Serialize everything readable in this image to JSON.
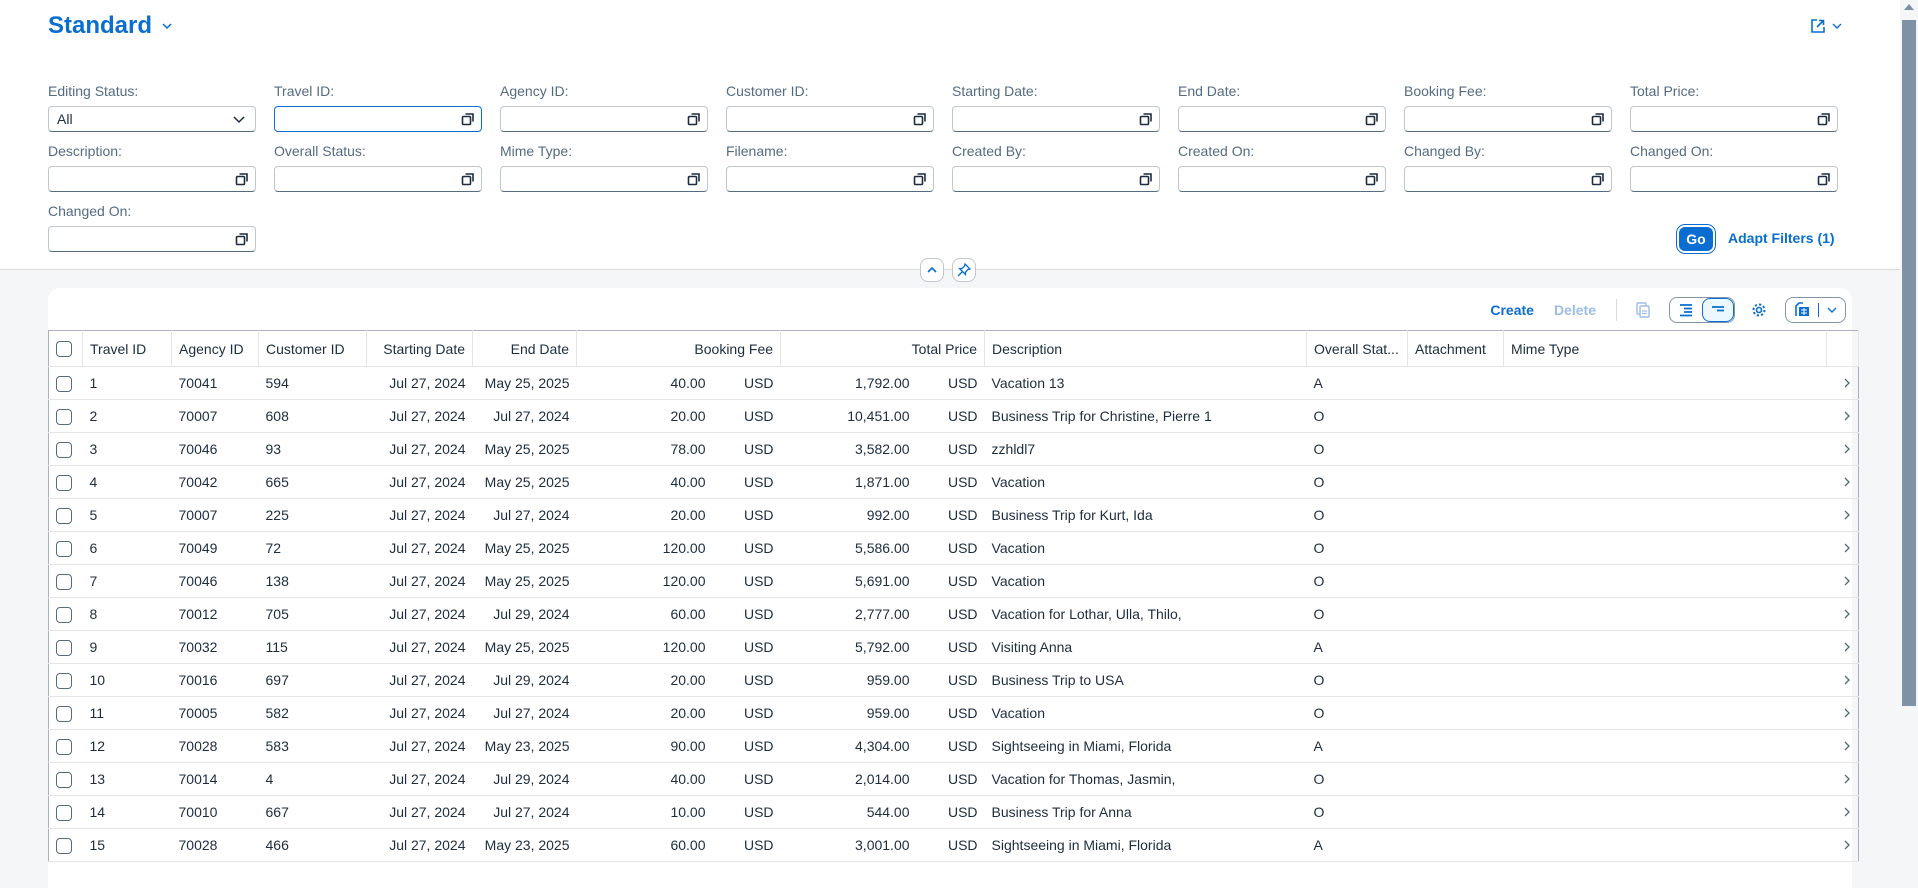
{
  "header": {
    "title": "Standard",
    "share_icon": "share-icon"
  },
  "filters": [
    {
      "label": "Editing Status:",
      "value": "All",
      "type": "select"
    },
    {
      "label": "Travel ID:",
      "value": "",
      "type": "valuehelp",
      "focused": true
    },
    {
      "label": "Agency ID:",
      "value": "",
      "type": "valuehelp"
    },
    {
      "label": "Customer ID:",
      "value": "",
      "type": "valuehelp"
    },
    {
      "label": "Starting Date:",
      "value": "",
      "type": "valuehelp"
    },
    {
      "label": "End Date:",
      "value": "",
      "type": "valuehelp"
    },
    {
      "label": "Booking Fee:",
      "value": "",
      "type": "valuehelp"
    },
    {
      "label": "Total Price:",
      "value": "",
      "type": "valuehelp"
    },
    {
      "label": "Description:",
      "value": "",
      "type": "valuehelp"
    },
    {
      "label": "Overall Status:",
      "value": "",
      "type": "valuehelp"
    },
    {
      "label": "Mime Type:",
      "value": "",
      "type": "valuehelp"
    },
    {
      "label": "Filename:",
      "value": "",
      "type": "valuehelp"
    },
    {
      "label": "Created By:",
      "value": "",
      "type": "valuehelp"
    },
    {
      "label": "Created On:",
      "value": "",
      "type": "valuehelp"
    },
    {
      "label": "Changed By:",
      "value": "",
      "type": "valuehelp"
    },
    {
      "label": "Changed On:",
      "value": "",
      "type": "valuehelp"
    },
    {
      "label": "Changed On:",
      "value": "",
      "type": "valuehelp"
    }
  ],
  "filterbar": {
    "go_label": "Go",
    "adapt_label": "Adapt Filters (1)"
  },
  "toolbar": {
    "create_label": "Create",
    "delete_label": "Delete"
  },
  "table": {
    "columns": [
      "Travel ID",
      "Agency ID",
      "Customer ID",
      "Starting Date",
      "End Date",
      "Booking Fee",
      "Total Price",
      "Description",
      "Overall Stat...",
      "Attachment",
      "Mime Type"
    ],
    "rows": [
      {
        "travel_id": "1",
        "agency_id": "70041",
        "customer_id": "594",
        "start": "Jul 27, 2024",
        "end": "May 25, 2025",
        "fee": "40.00",
        "fee_cur": "USD",
        "total": "1,792.00",
        "total_cur": "USD",
        "desc": "Vacation 13",
        "status": "A",
        "attachment": "",
        "mime": ""
      },
      {
        "travel_id": "2",
        "agency_id": "70007",
        "customer_id": "608",
        "start": "Jul 27, 2024",
        "end": "Jul 27, 2024",
        "fee": "20.00",
        "fee_cur": "USD",
        "total": "10,451.00",
        "total_cur": "USD",
        "desc": "Business Trip for Christine, Pierre 1",
        "status": "O",
        "attachment": "",
        "mime": ""
      },
      {
        "travel_id": "3",
        "agency_id": "70046",
        "customer_id": "93",
        "start": "Jul 27, 2024",
        "end": "May 25, 2025",
        "fee": "78.00",
        "fee_cur": "USD",
        "total": "3,582.00",
        "total_cur": "USD",
        "desc": "zzhldl7",
        "status": "O",
        "attachment": "",
        "mime": ""
      },
      {
        "travel_id": "4",
        "agency_id": "70042",
        "customer_id": "665",
        "start": "Jul 27, 2024",
        "end": "May 25, 2025",
        "fee": "40.00",
        "fee_cur": "USD",
        "total": "1,871.00",
        "total_cur": "USD",
        "desc": "Vacation",
        "status": "O",
        "attachment": "",
        "mime": ""
      },
      {
        "travel_id": "5",
        "agency_id": "70007",
        "customer_id": "225",
        "start": "Jul 27, 2024",
        "end": "Jul 27, 2024",
        "fee": "20.00",
        "fee_cur": "USD",
        "total": "992.00",
        "total_cur": "USD",
        "desc": "Business Trip for Kurt, Ida",
        "status": "O",
        "attachment": "",
        "mime": ""
      },
      {
        "travel_id": "6",
        "agency_id": "70049",
        "customer_id": "72",
        "start": "Jul 27, 2024",
        "end": "May 25, 2025",
        "fee": "120.00",
        "fee_cur": "USD",
        "total": "5,586.00",
        "total_cur": "USD",
        "desc": "Vacation",
        "status": "O",
        "attachment": "",
        "mime": ""
      },
      {
        "travel_id": "7",
        "agency_id": "70046",
        "customer_id": "138",
        "start": "Jul 27, 2024",
        "end": "May 25, 2025",
        "fee": "120.00",
        "fee_cur": "USD",
        "total": "5,691.00",
        "total_cur": "USD",
        "desc": "Vacation",
        "status": "O",
        "attachment": "",
        "mime": ""
      },
      {
        "travel_id": "8",
        "agency_id": "70012",
        "customer_id": "705",
        "start": "Jul 27, 2024",
        "end": "Jul 29, 2024",
        "fee": "60.00",
        "fee_cur": "USD",
        "total": "2,777.00",
        "total_cur": "USD",
        "desc": "Vacation for Lothar, Ulla, Thilo,",
        "status": "O",
        "attachment": "",
        "mime": ""
      },
      {
        "travel_id": "9",
        "agency_id": "70032",
        "customer_id": "115",
        "start": "Jul 27, 2024",
        "end": "May 25, 2025",
        "fee": "120.00",
        "fee_cur": "USD",
        "total": "5,792.00",
        "total_cur": "USD",
        "desc": "Visiting Anna",
        "status": "A",
        "attachment": "",
        "mime": ""
      },
      {
        "travel_id": "10",
        "agency_id": "70016",
        "customer_id": "697",
        "start": "Jul 27, 2024",
        "end": "Jul 29, 2024",
        "fee": "20.00",
        "fee_cur": "USD",
        "total": "959.00",
        "total_cur": "USD",
        "desc": "Business Trip to USA",
        "status": "O",
        "attachment": "",
        "mime": ""
      },
      {
        "travel_id": "11",
        "agency_id": "70005",
        "customer_id": "582",
        "start": "Jul 27, 2024",
        "end": "Jul 27, 2024",
        "fee": "20.00",
        "fee_cur": "USD",
        "total": "959.00",
        "total_cur": "USD",
        "desc": "Vacation",
        "status": "O",
        "attachment": "",
        "mime": ""
      },
      {
        "travel_id": "12",
        "agency_id": "70028",
        "customer_id": "583",
        "start": "Jul 27, 2024",
        "end": "May 23, 2025",
        "fee": "90.00",
        "fee_cur": "USD",
        "total": "4,304.00",
        "total_cur": "USD",
        "desc": "Sightseeing in Miami, Florida",
        "status": "A",
        "attachment": "",
        "mime": ""
      },
      {
        "travel_id": "13",
        "agency_id": "70014",
        "customer_id": "4",
        "start": "Jul 27, 2024",
        "end": "Jul 29, 2024",
        "fee": "40.00",
        "fee_cur": "USD",
        "total": "2,014.00",
        "total_cur": "USD",
        "desc": "Vacation for Thomas, Jasmin,",
        "status": "O",
        "attachment": "",
        "mime": ""
      },
      {
        "travel_id": "14",
        "agency_id": "70010",
        "customer_id": "667",
        "start": "Jul 27, 2024",
        "end": "Jul 27, 2024",
        "fee": "10.00",
        "fee_cur": "USD",
        "total": "544.00",
        "total_cur": "USD",
        "desc": "Business Trip for Anna",
        "status": "O",
        "attachment": "",
        "mime": ""
      },
      {
        "travel_id": "15",
        "agency_id": "70028",
        "customer_id": "466",
        "start": "Jul 27, 2024",
        "end": "May 23, 2025",
        "fee": "60.00",
        "fee_cur": "USD",
        "total": "3,001.00",
        "total_cur": "USD",
        "desc": "Sightseeing in Miami, Florida",
        "status": "A",
        "attachment": "",
        "mime": ""
      }
    ]
  },
  "colors": {
    "accent": "#0a6ed1",
    "text": "#1d2d3e",
    "label": "#556b82",
    "disabled": "#9dbde5"
  }
}
